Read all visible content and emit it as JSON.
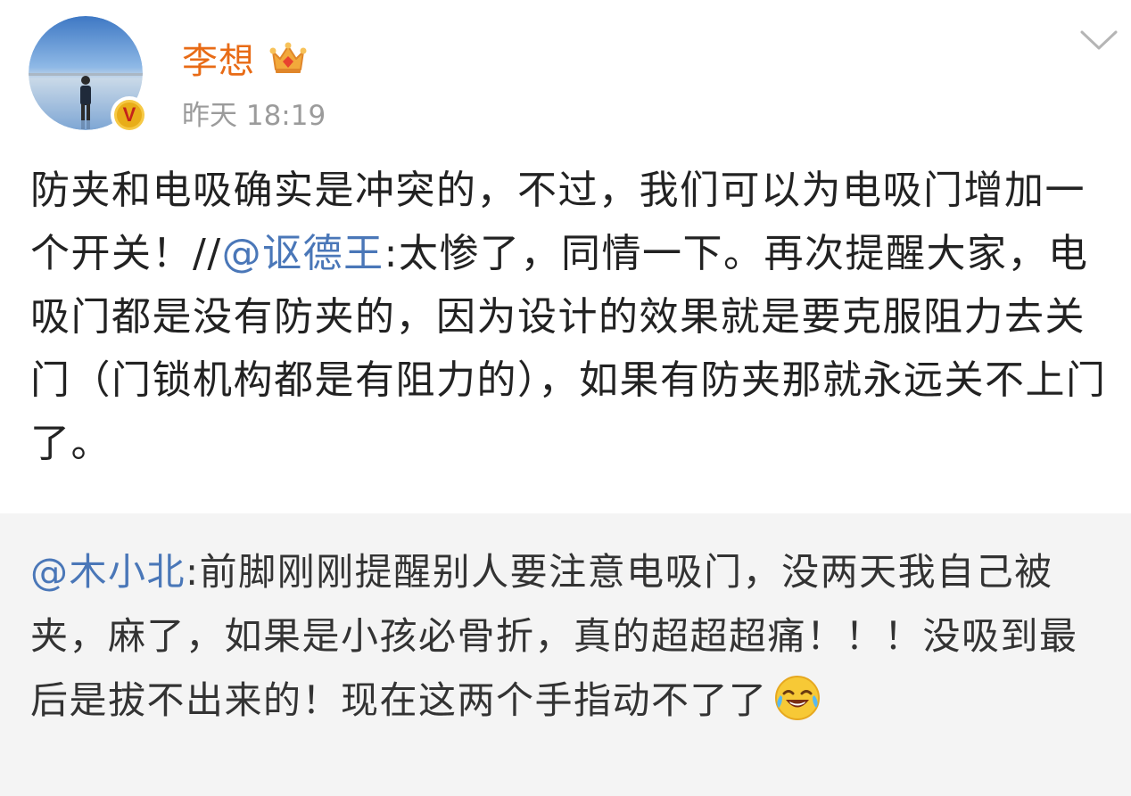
{
  "header": {
    "author_name": "李想",
    "timestamp": "昨天 18:19",
    "verified_badge": "V",
    "vip_icon": "crown-icon",
    "menu_icon": "chevron-down-icon"
  },
  "main": {
    "text_before_mention": "防夹和电吸确实是冲突的，不过，我们可以为电吸门增加一个开关！//",
    "mention": "@讴德王",
    "text_after_mention": ":太惨了，同情一下。再次提醒大家，电吸门都是没有防夹的，因为设计的效果就是要克服阻力去关门（门锁机构都是有阻力的），如果有防夹那就永远关不上门了。"
  },
  "repost": {
    "mention": "@木小北",
    "text": ":前脚刚刚提醒别人要注意电吸门，没两天我自己被夹，麻了，如果是小孩必骨折，真的超超超痛！！！没吸到最后是拔不出来的！现在这两个手指动不了了",
    "emoji": "laugh-cry-emoji-icon"
  },
  "colors": {
    "author_name": "#e86b16",
    "mention": "#4a77b8",
    "timestamp": "#9b9b9b",
    "body_text": "#222222",
    "repost_background": "#f4f4f4"
  }
}
